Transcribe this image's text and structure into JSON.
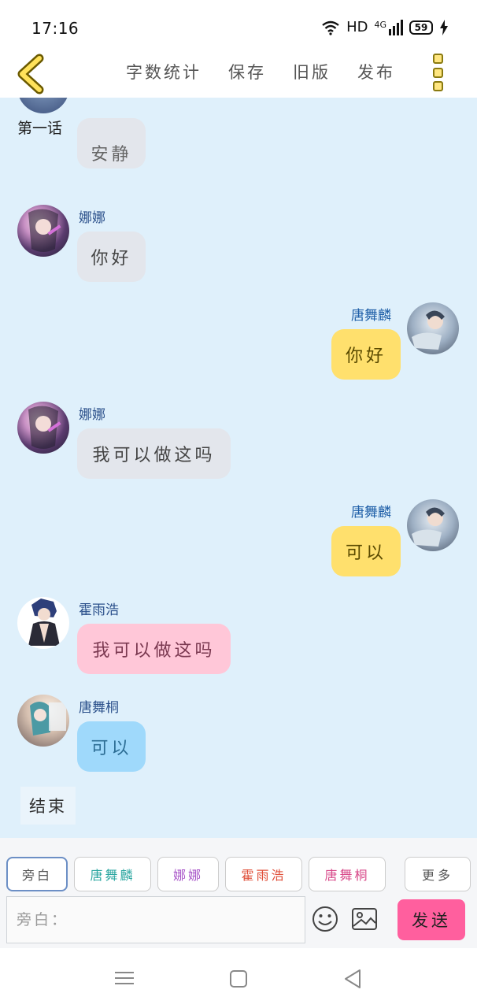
{
  "status_bar": {
    "time": "17:16",
    "network": "HD",
    "signal": "4G",
    "battery": "59"
  },
  "toolbar": {
    "items": [
      "字数统计",
      "保存",
      "旧版",
      "发布"
    ]
  },
  "chat": {
    "chapter_title": "第一话",
    "partial_message": "安静",
    "messages": [
      {
        "side": "left",
        "name": "娜娜",
        "text": "你好",
        "bubble": "grey"
      },
      {
        "side": "right",
        "name": "唐舞麟",
        "text": "你好",
        "bubble": "yellow"
      },
      {
        "side": "left",
        "name": "娜娜",
        "text": "我可以做这吗",
        "bubble": "grey"
      },
      {
        "side": "right",
        "name": "唐舞麟",
        "text": "可以",
        "bubble": "yellow"
      },
      {
        "side": "left",
        "name": "霍雨浩",
        "text": "我可以做这吗",
        "bubble": "pink"
      },
      {
        "side": "left",
        "name": "唐舞桐",
        "text": "可以",
        "bubble": "blue"
      }
    ],
    "end_label": "结束"
  },
  "composer": {
    "chips": [
      {
        "label": "旁白",
        "color": "#555555"
      },
      {
        "label": "唐舞麟",
        "color": "#2aa6a0"
      },
      {
        "label": "娜娜",
        "color": "#a855c8"
      },
      {
        "label": "霍雨浩",
        "color": "#e0503a"
      },
      {
        "label": "唐舞桐",
        "color": "#d84a8a"
      }
    ],
    "more_label": "更多",
    "input_placeholder": "旁白：",
    "send_label": "发送"
  },
  "colors": {
    "chat_background": "#dff0fb",
    "accent_yellow": "#ffe06d",
    "send_pink": "#ff5f9e"
  }
}
